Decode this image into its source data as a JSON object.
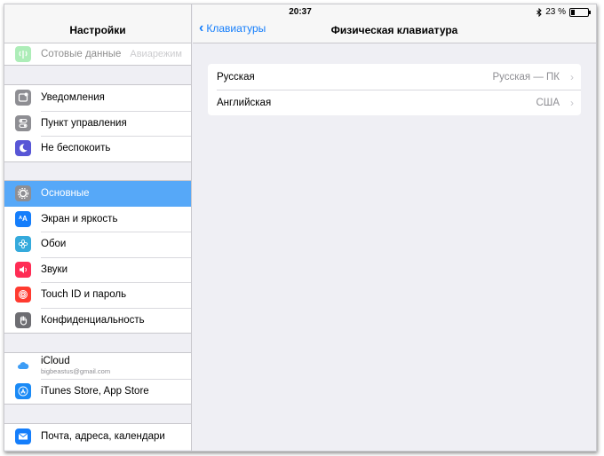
{
  "status": {
    "time": "20:37",
    "battery": "23 %",
    "battery_level": 0.23
  },
  "sidebar": {
    "title": "Настройки",
    "top_partial": {
      "label": "Сотовые данные",
      "right": "Авиарежим"
    },
    "group1": [
      {
        "label": "Уведомления",
        "icon": "notifications-icon",
        "color": "#8e8e93"
      },
      {
        "label": "Пункт управления",
        "icon": "control-center-icon",
        "color": "#8e8e93"
      },
      {
        "label": "Не беспокоить",
        "icon": "moon-icon",
        "color": "#5856d6"
      }
    ],
    "group2": [
      {
        "label": "Основные",
        "icon": "gear-icon",
        "color": "#8e8e93",
        "selected": true
      },
      {
        "label": "Экран и яркость",
        "icon": "display-brightness-icon",
        "color": "#157efb"
      },
      {
        "label": "Обои",
        "icon": "wallpaper-icon",
        "color": "#35aadc"
      },
      {
        "label": "Звуки",
        "icon": "sound-icon",
        "color": "#ff2d55"
      },
      {
        "label": "Touch ID и пароль",
        "icon": "fingerprint-icon",
        "color": "#ff3b30"
      },
      {
        "label": "Конфиденциальность",
        "icon": "privacy-hand-icon",
        "color": "#6d6d72"
      }
    ],
    "group3": [
      {
        "label": "iCloud",
        "sub": "bigbeastus@gmail.com",
        "icon": "icloud-icon",
        "color": "#ffffff"
      },
      {
        "label": "iTunes Store, App Store",
        "icon": "app-store-icon",
        "color": "#1a8af6"
      }
    ],
    "group4": [
      {
        "label": "Почта, адреса, календари",
        "icon": "mail-icon",
        "color": "#157efb"
      }
    ]
  },
  "detail": {
    "back_label": "Клавиатуры",
    "title": "Физическая клавиатура",
    "rows": [
      {
        "label": "Русская",
        "value": "Русская — ПК"
      },
      {
        "label": "Английская",
        "value": "США"
      }
    ]
  }
}
